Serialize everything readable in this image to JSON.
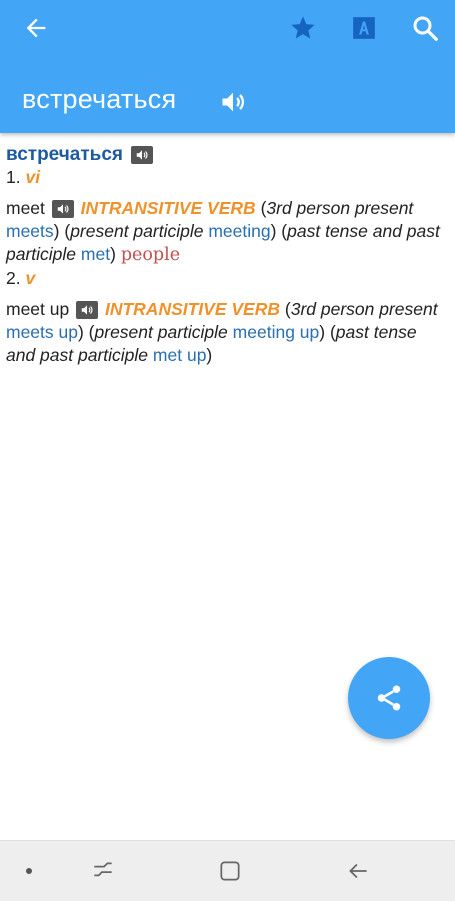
{
  "header": {
    "title": "встречаться",
    "icons": [
      "back-arrow-icon",
      "star-icon",
      "font-icon",
      "search-icon",
      "speaker-icon"
    ]
  },
  "entry": {
    "headword": "встречаться",
    "senses": [
      {
        "number": "1.",
        "pos": "vi",
        "translation": "meet",
        "grammar": "INTRANSITIVE VERB",
        "paren1_open": "(",
        "f1_label": "3rd person present",
        "f1_value": "meets",
        "mid1": ") (",
        "f2_label": "present participle",
        "f2_value": "meeting",
        "mid2": ") (",
        "f3_label": "past tense and past participle",
        "f3_value": "met",
        "close": ")",
        "tag": "people"
      },
      {
        "number": "2.",
        "pos": "v",
        "translation": "meet up",
        "grammar": "INTRANSITIVE VERB",
        "paren1_open": "(",
        "f1_label": "3rd person present",
        "f1_value": "meets up",
        "mid1": ") (",
        "f2_label": "present participle",
        "f2_value": "meeting up",
        "mid2": ") (",
        "f3_label": "past tense and past participle",
        "f3_value": "met up",
        "close": ")"
      }
    ]
  },
  "fab": {
    "icon": "share-icon"
  },
  "navbar": {
    "icons": [
      "dot-icon",
      "recent-apps-icon",
      "home-icon",
      "back-icon"
    ]
  },
  "colors": {
    "primary": "#42a5f5",
    "headword": "#1e5aa0",
    "grammar": "#f0922b",
    "link": "#2a6fb0",
    "tag": "#c0504d"
  }
}
